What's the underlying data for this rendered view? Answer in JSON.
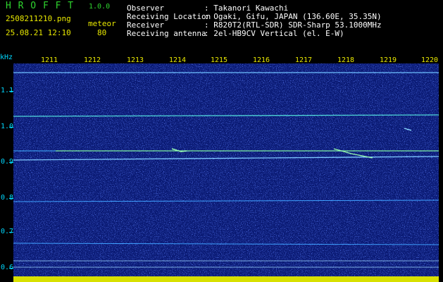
{
  "header": {
    "logo_text": "H R O F F T",
    "version": "1.0.0",
    "file_name": "2508211210.png",
    "datetime": "25.08.21 12:10",
    "meteor_label": "meteor",
    "meteor_count": "80",
    "info": [
      {
        "key": "Observer",
        "value": ": Takanori Kawachi"
      },
      {
        "key": "Receiving Location",
        "value": ": Ogaki, Gifu, JAPAN (136.60E, 35.35N)"
      },
      {
        "key": "Receiver",
        "value": ": R820T2(RTL-SDR) SDR-Sharp 53.1000MHz"
      },
      {
        "key": "Receiving antenna",
        "value": ": 2el-HB9CV Vertical (el. E-W)"
      }
    ]
  },
  "axis": {
    "y_unit": "kHz",
    "y_labels": [
      "1.1",
      "1.0",
      "0.9",
      "0.8",
      "0.7",
      "0.6"
    ],
    "x_labels": [
      "1211",
      "1212",
      "1213",
      "1214",
      "1215",
      "1216",
      "1217",
      "1218",
      "1219",
      "1220"
    ]
  },
  "colors": {
    "text_green": "#2fd52f",
    "text_yellow": "#e8e800",
    "text_white": "#ffffff",
    "axis_cyan": "#00d8ff",
    "plot_bg": "#0a1a74",
    "bar_yellow": "#d8e000"
  }
}
